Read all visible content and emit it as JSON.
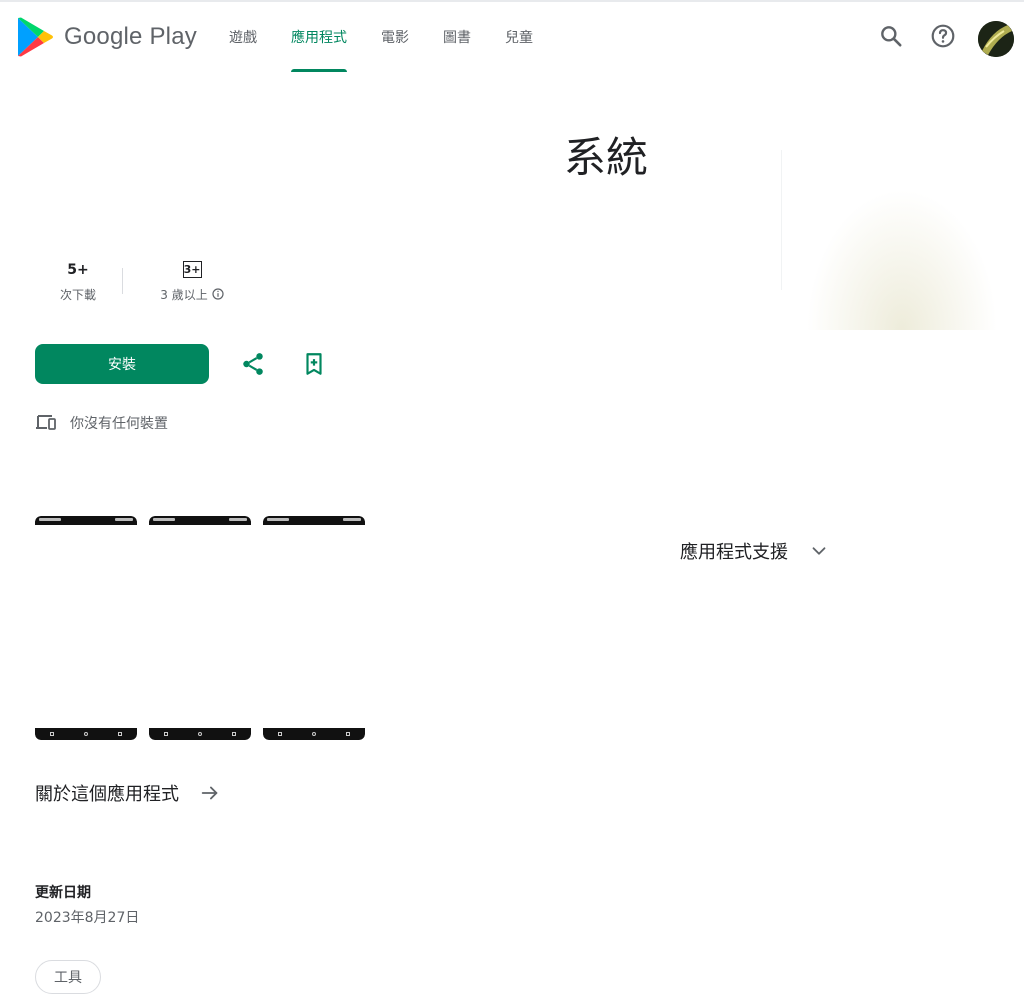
{
  "brand": {
    "name": "Google Play",
    "logo_icon": "google-play-logo",
    "accent_color": "#01875f"
  },
  "nav": {
    "tabs": [
      {
        "label": "遊戲",
        "active": false
      },
      {
        "label": "應用程式",
        "active": true
      },
      {
        "label": "電影",
        "active": false
      },
      {
        "label": "圖書",
        "active": false
      },
      {
        "label": "兒童",
        "active": false
      }
    ]
  },
  "header_icons": [
    "search-icon",
    "help-icon",
    "account-avatar"
  ],
  "app": {
    "title": "系統",
    "downloads_value": "5+",
    "downloads_label": "次下載",
    "rating_badge": "3+",
    "rating_label": "3 歲以上"
  },
  "actions": {
    "install_label": "安裝",
    "share_icon": "share-icon",
    "wishlist_icon": "bookmark-add-icon"
  },
  "device": {
    "icon": "devices-icon",
    "text": "你沒有任何裝置"
  },
  "screenshots_count": 3,
  "support": {
    "label": "應用程式支援"
  },
  "about": {
    "label": "關於這個應用程式"
  },
  "updated": {
    "label": "更新日期",
    "value": "2023年8月27日"
  },
  "category_chip": "工具"
}
